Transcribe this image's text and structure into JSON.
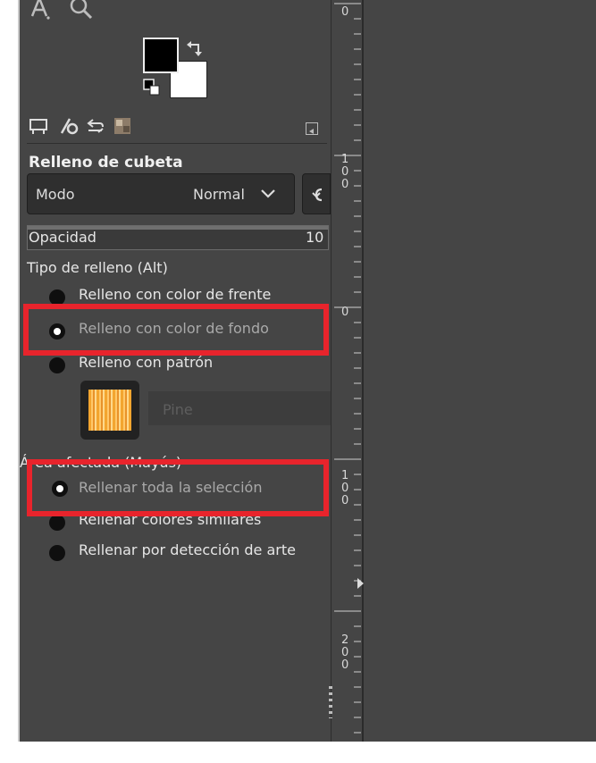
{
  "tool_options": {
    "title": "Relleno de cubeta",
    "mode": {
      "label": "Modo",
      "value": "Normal"
    },
    "opacity": {
      "label": "Opacidad",
      "value": "10",
      "level_percent": 100
    },
    "fill_type": {
      "heading": "Tipo de relleno  (Alt)",
      "options": [
        {
          "label": "Relleno con color de frente",
          "selected": false
        },
        {
          "label": "Relleno con color de fondo",
          "selected": true
        },
        {
          "label": "Relleno con patrón",
          "selected": false
        }
      ]
    },
    "pattern": {
      "name": "Pine",
      "swatch_color": "#f3a52f"
    },
    "affected_area": {
      "heading": "Área afectada  (Mayús)",
      "options": [
        {
          "label": "Rellenar toda la selección",
          "selected": true
        },
        {
          "label": "Rellenar colores similares",
          "selected": false
        },
        {
          "label": "Rellenar por detección de arte",
          "selected": false
        }
      ]
    }
  },
  "colors": {
    "foreground": "#000000",
    "background": "#ffffff",
    "highlight_box": "#e8242c",
    "panel_bg": "#454545"
  },
  "tabs": [
    {
      "icon": "tool-options-icon"
    },
    {
      "icon": "device-status-icon"
    },
    {
      "icon": "undo-history-icon"
    },
    {
      "icon": "images-icon"
    }
  ],
  "ruler": {
    "labels": [
      {
        "digits": [
          "0"
        ]
      },
      {
        "digits": [
          "1",
          "0",
          "0"
        ]
      },
      {
        "digits": [
          "0"
        ]
      },
      {
        "digits": [
          "1",
          "0",
          "0"
        ]
      },
      {
        "digits": [
          "2",
          "0",
          "0"
        ]
      }
    ]
  }
}
